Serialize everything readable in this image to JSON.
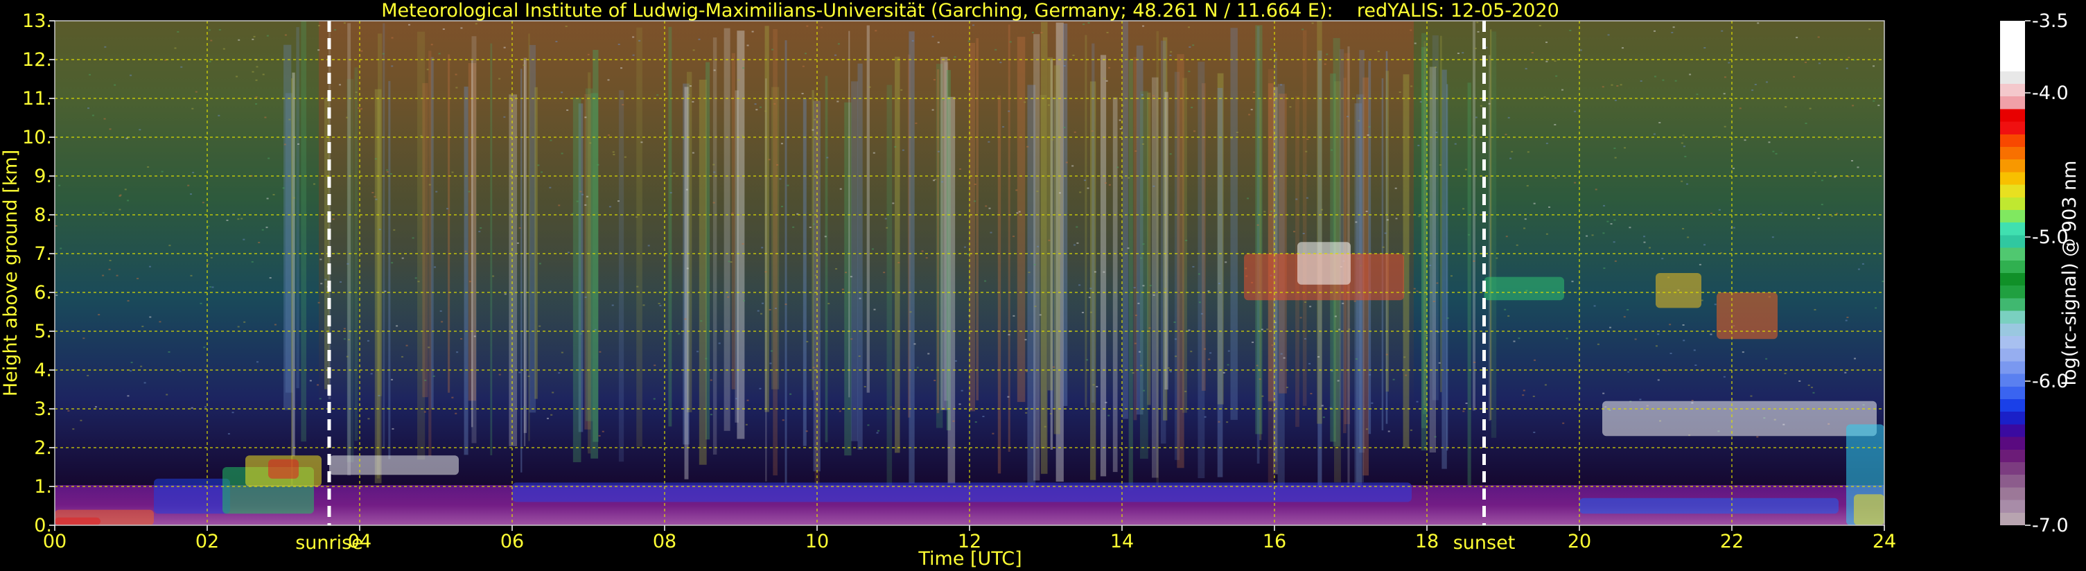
{
  "chart_data": {
    "type": "heatmap",
    "title": "Meteorological Institute of Ludwig-Maximilians-Universität (Garching, Germany; 48.261 N / 11.664 E):    redYALIS: 12-05-2020",
    "xlabel": "Time [UTC]",
    "ylabel": "Height above ground [km]",
    "xlim": [
      0,
      24
    ],
    "ylim": [
      0,
      13
    ],
    "x_ticks": [
      {
        "value": 0,
        "label": "00"
      },
      {
        "value": 2,
        "label": "02"
      },
      {
        "value": 4,
        "label": "04"
      },
      {
        "value": 6,
        "label": "06"
      },
      {
        "value": 8,
        "label": "08"
      },
      {
        "value": 10,
        "label": "10"
      },
      {
        "value": 12,
        "label": "12"
      },
      {
        "value": 14,
        "label": "14"
      },
      {
        "value": 16,
        "label": "16"
      },
      {
        "value": 18,
        "label": "18"
      },
      {
        "value": 20,
        "label": "20"
      },
      {
        "value": 22,
        "label": "22"
      },
      {
        "value": 24,
        "label": "24"
      }
    ],
    "y_ticks": [
      {
        "value": 0,
        "label": "0."
      },
      {
        "value": 1,
        "label": "1."
      },
      {
        "value": 2,
        "label": "2."
      },
      {
        "value": 3,
        "label": "3."
      },
      {
        "value": 4,
        "label": "4."
      },
      {
        "value": 5,
        "label": "5."
      },
      {
        "value": 6,
        "label": "6."
      },
      {
        "value": 7,
        "label": "7."
      },
      {
        "value": 8,
        "label": "8."
      },
      {
        "value": 9,
        "label": "9."
      },
      {
        "value": 10,
        "label": "10."
      },
      {
        "value": 11,
        "label": "11."
      },
      {
        "value": 12,
        "label": "12."
      },
      {
        "value": 13,
        "label": "13."
      }
    ],
    "grid": true,
    "markers": [
      {
        "label": "sunrise",
        "x": 3.6
      },
      {
        "label": "sunset",
        "x": 18.75
      }
    ],
    "colorbar": {
      "label": "log(rc-signal) @ 903 nm",
      "range": [
        -7.0,
        -3.5
      ],
      "ticks": [
        {
          "value": -3.5,
          "label": "-3.5"
        },
        {
          "value": -4.0,
          "label": "-4.0"
        },
        {
          "value": -5.0,
          "label": "-5.0"
        },
        {
          "value": -6.0,
          "label": "-6.0"
        },
        {
          "value": -7.0,
          "label": "-7.0"
        }
      ],
      "colors_bottom_to_top": [
        "#b8a4b0",
        "#a88ca8",
        "#9c7898",
        "#8c5c8c",
        "#7c3c80",
        "#6c1c78",
        "#5a0a80",
        "#3a0aa0",
        "#1a20c8",
        "#1a40e8",
        "#3a64f0",
        "#5a80f0",
        "#7a98f0",
        "#96aef0",
        "#a8c0f0",
        "#9ac8e0",
        "#7ad0c0",
        "#40b870",
        "#20a040",
        "#109028",
        "#30b050",
        "#50c870",
        "#30c8a0",
        "#40e0b0",
        "#80e860",
        "#c0e830",
        "#e8e020",
        "#f8c000",
        "#f89800",
        "#f87000",
        "#f84800",
        "#f01010",
        "#e80000",
        "#f0a0a8",
        "#f4c8cc",
        "#e8e8e8",
        "#ffffff",
        "#ffffff",
        "#ffffff",
        "#ffffff"
      ]
    },
    "colors": {
      "text": "#ffff33",
      "grid": "#e0e000",
      "background": "#000000"
    }
  }
}
